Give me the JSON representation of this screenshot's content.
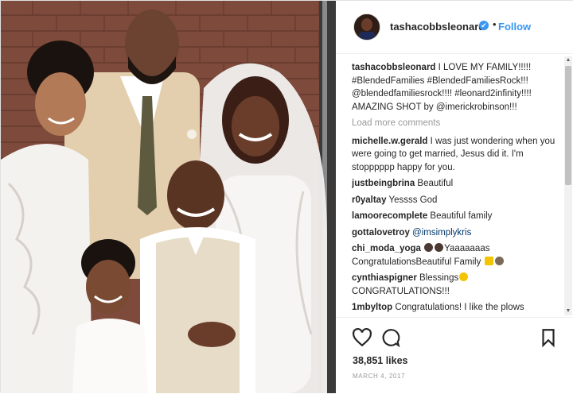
{
  "post": {
    "username": "tashacobbsleonard",
    "verified_mark": "✔",
    "dot": "•",
    "follow_label": "Follow",
    "caption": {
      "user": "tashacobbsleonard",
      "text": " I LOVE MY FAMILY!!!!! #BlendedFamilies #BlendedFamiliesRock!!! @blendedfamiliesrock!!!! #leonard2infinity!!!! AMAZING SHOT by @imerickrobinson!!!"
    },
    "load_more": "Load more comments",
    "comments": [
      {
        "user": "michelle.w.gerald",
        "text": " I was just wondering when you were going to get married, Jesus did it. I'm stopppppp happy for you."
      },
      {
        "user": "justbeingbrina",
        "text": " Beautiful"
      },
      {
        "user": "r0yaltay",
        "text": " Yessss God"
      },
      {
        "user": "lamoorecomplete",
        "text": " Beautiful family"
      },
      {
        "user": "gottalovetroy",
        "text": " @imsimplykris"
      },
      {
        "user": "chi_moda_yoga",
        "text_before": "",
        "text_after": "Yaaaaaaas CongratulationsBeautiful Family"
      },
      {
        "user": "cynthiaspigner",
        "text_before": " Blessings",
        "text_after": " CONGRATULATIONS!!!"
      },
      {
        "user": "1mbyltop",
        "text": " Congratulations! I like the plows"
      }
    ],
    "likes": "38,851 likes",
    "date": "MARCH 4, 2017",
    "icons": {
      "like": "heart-icon",
      "comment": "comment-icon",
      "save": "bookmark-icon"
    },
    "colors": {
      "link_blue": "#3897f0",
      "text": "#262626",
      "muted": "#999999"
    }
  }
}
